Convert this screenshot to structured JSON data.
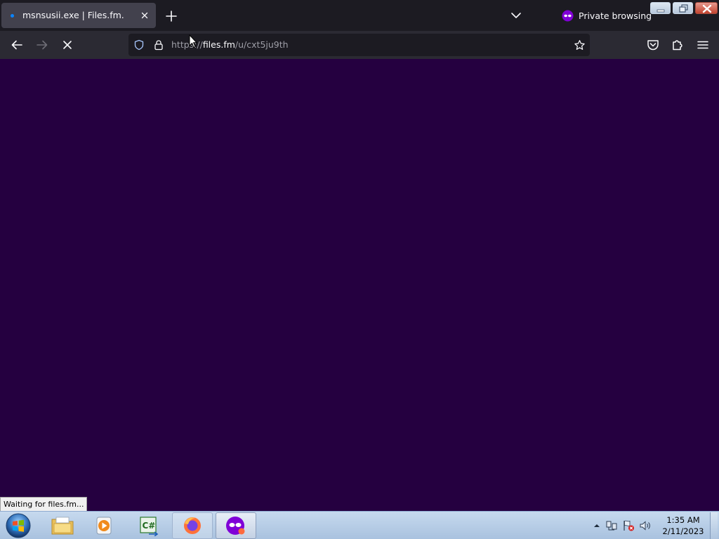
{
  "tab": {
    "title": "msnsusii.exe | Files.fm."
  },
  "private": {
    "label": "Private browsing"
  },
  "urlbar": {
    "scheme": "https://",
    "host": "files.fm",
    "path": "/u/cxt5ju9th"
  },
  "status": {
    "text": "Waiting for files.fm..."
  },
  "clock": {
    "time": "1:35 AM",
    "date": "2/11/2023"
  },
  "colors": {
    "content_bg": "#250040",
    "tabstrip_bg": "#1c1b22",
    "navbar_bg": "#2b2a33",
    "private_accent": "#8000d7"
  },
  "icons": {
    "tab_close": "close-icon",
    "new_tab": "plus-icon",
    "all_tabs": "chevron-down-icon",
    "private": "private-mask-icon",
    "back": "arrow-left-icon",
    "forward": "arrow-right-icon",
    "stop": "stop-x-icon",
    "tracking": "shield-icon",
    "secure": "lock-icon",
    "bookmark": "star-icon",
    "pocket": "pocket-icon",
    "extensions": "puzzle-icon",
    "menu": "hamburger-icon"
  }
}
